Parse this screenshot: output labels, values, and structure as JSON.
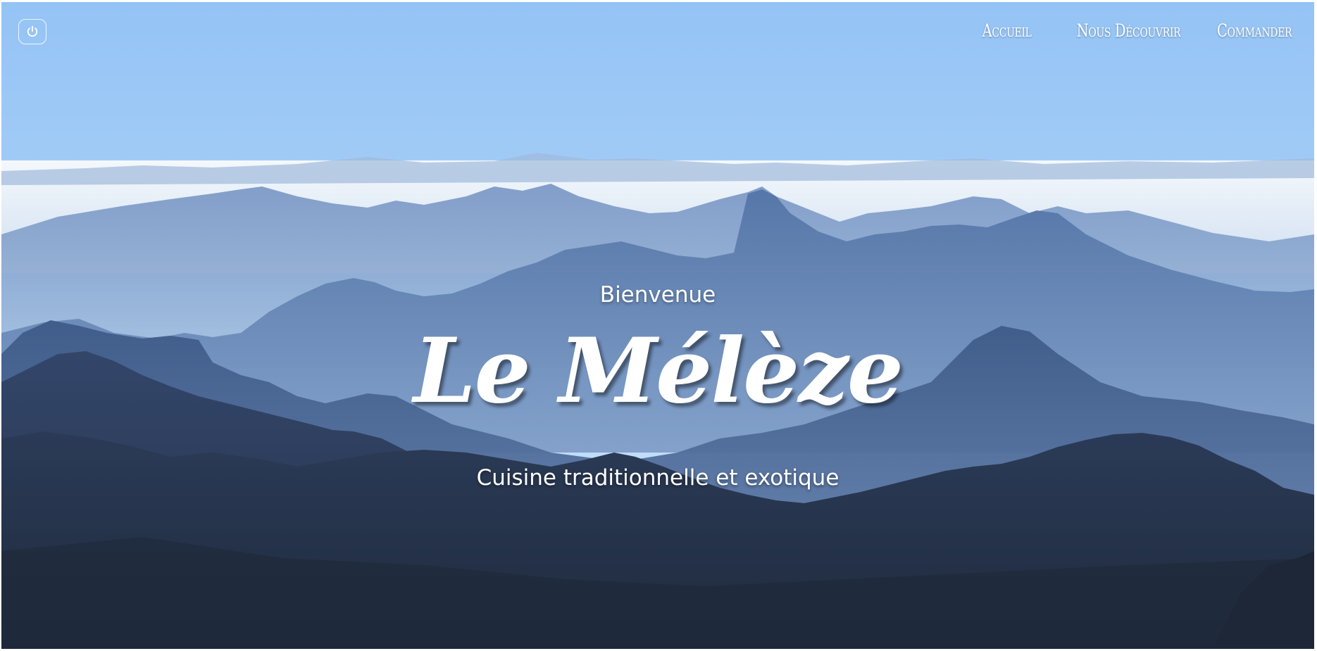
{
  "header": {
    "power_icon": "power-icon",
    "nav": {
      "home": "Accueil",
      "about": "Nous Découvrir",
      "order": "Commander"
    }
  },
  "hero": {
    "welcome": "Bienvenue",
    "brand": "Le Mélèze",
    "tagline": "Cuisine traditionnelle et exotique",
    "background": "misty-mountain-range-photo"
  },
  "colors": {
    "sky": "#9bc8f6",
    "mist": "#eef5fb",
    "far_mountains": "#7fa2cd",
    "near_mountains": "#2c3c58",
    "text": "#ffffff"
  }
}
